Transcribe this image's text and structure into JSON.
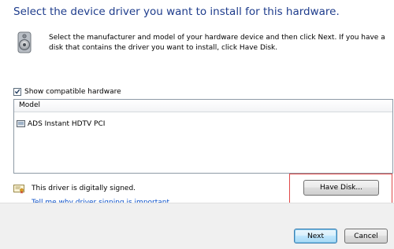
{
  "header": {
    "title": "Select the device driver you want to install for this hardware."
  },
  "intro": {
    "icon": "speaker-icon",
    "text": "Select the manufacturer and model of your hardware device and then click Next. If you have a disk that contains the driver you want to install, click Have Disk."
  },
  "compatible": {
    "label": "Show compatible hardware",
    "checked": true
  },
  "model_list": {
    "column_header": "Model",
    "items": [
      {
        "label": "ADS Instant HDTV PCI",
        "icon": "device-icon"
      }
    ]
  },
  "signing": {
    "icon": "certificate-icon",
    "status": "This driver is digitally signed.",
    "link": "Tell me why driver signing is important"
  },
  "buttons": {
    "have_disk": "Have Disk...",
    "next": "Next",
    "cancel": "Cancel"
  },
  "colors": {
    "heading": "#1e3c8c",
    "link": "#0b50c8",
    "highlight": "#e04848",
    "footer": "#f0f0f0"
  }
}
